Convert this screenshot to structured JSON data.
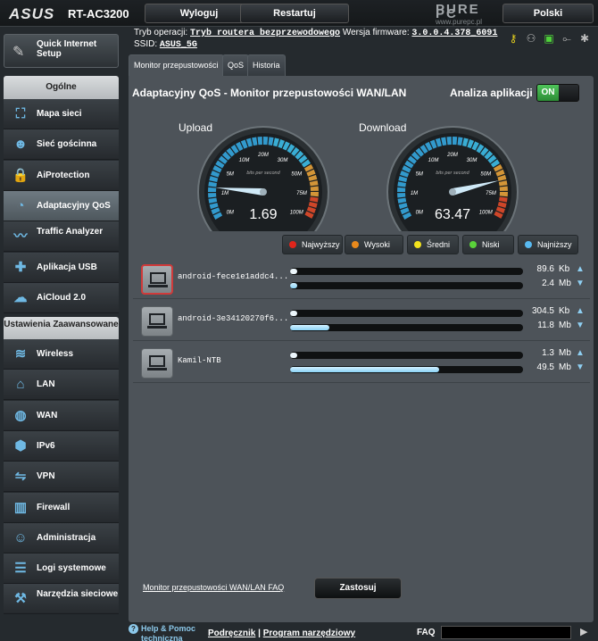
{
  "header": {
    "brand": "ASUS",
    "model": "RT-AC3200",
    "logout_label": "Wyloguj",
    "restart_label": "Restartuj",
    "language": "Polski"
  },
  "watermark": {
    "line1": "PURE",
    "line2": "PC",
    "line3": "www.purepc.pl"
  },
  "info": {
    "mode_label": "Tryb operacji:",
    "mode_value": "Tryb routera bezprzewodowego",
    "firmware_label": "Wersja firmware:",
    "firmware_value": "3.0.0.4.378_6091",
    "ssid_label": "SSID:",
    "ssid_value": "ASUS_5G"
  },
  "status_icons": [
    "key-icon",
    "network-clients-icon",
    "wan-status-icon",
    "usb-icon",
    "settings-icon"
  ],
  "sidebar": {
    "qis_label": "Quick Internet Setup",
    "general_heading": "Ogólne",
    "general": [
      {
        "label": "Mapa sieci",
        "icon": "network-map-icon"
      },
      {
        "label": "Sieć gościnna",
        "icon": "guest-network-icon"
      },
      {
        "label": "AiProtection",
        "icon": "lock-icon"
      },
      {
        "label": "Adaptacyjny QoS",
        "icon": "speedometer-icon",
        "active": true
      },
      {
        "label": "Traffic Analyzer",
        "icon": "chart-icon"
      },
      {
        "label": "Aplikacja USB",
        "icon": "puzzle-icon"
      },
      {
        "label": "AiCloud 2.0",
        "icon": "cloud-icon"
      }
    ],
    "advanced_heading": "Ustawienia Zaawansowane",
    "advanced": [
      {
        "label": "Wireless",
        "icon": "wifi-icon"
      },
      {
        "label": "LAN",
        "icon": "home-icon"
      },
      {
        "label": "WAN",
        "icon": "globe-icon"
      },
      {
        "label": "IPv6",
        "icon": "ipv6-icon"
      },
      {
        "label": "VPN",
        "icon": "vpn-icon"
      },
      {
        "label": "Firewall",
        "icon": "firewall-icon"
      },
      {
        "label": "Administracja",
        "icon": "admin-icon"
      },
      {
        "label": "Logi systemowe",
        "icon": "log-icon"
      },
      {
        "label": "Narzędzia sieciowe",
        "icon": "tools-icon"
      }
    ]
  },
  "tabs": [
    {
      "label": "Monitor przepustowości",
      "active": true
    },
    {
      "label": "QoS",
      "active": false
    },
    {
      "label": "Historia",
      "active": false
    }
  ],
  "main": {
    "title": "Adaptacyjny QoS - Monitor przepustowości WAN/LAN",
    "app_analysis_label": "Analiza aplikacji",
    "toggle_state": "ON"
  },
  "gauges": [
    {
      "label": "Upload",
      "value": "1.69",
      "level": 1.69
    },
    {
      "label": "Download",
      "value": "63.47",
      "level": 63.47
    }
  ],
  "gauge_ticks": [
    "0M",
    "1M",
    "5M",
    "10M",
    "20M",
    "30M",
    "50M",
    "75M",
    "100M"
  ],
  "gauge_unit": "bits per second",
  "priorities": [
    {
      "label": "Najwyższy",
      "color": "#e0251b"
    },
    {
      "label": "Wysoki",
      "color": "#e8891c"
    },
    {
      "label": "Średni",
      "color": "#f2e21d"
    },
    {
      "label": "Niski",
      "color": "#5ad23a"
    },
    {
      "label": "Najniższy",
      "color": "#58b9f0"
    }
  ],
  "devices": [
    {
      "name": "android-fece1e1addc4...",
      "selected": true,
      "up_value": "89.6",
      "up_unit": "Kb",
      "up_fill": 0.005,
      "down_value": "2.4",
      "down_unit": "Mb",
      "down_fill": 0.03
    },
    {
      "name": "android-3e34120270f6...",
      "selected": false,
      "up_value": "304.5",
      "up_unit": "Kb",
      "up_fill": 0.006,
      "down_value": "11.8",
      "down_unit": "Mb",
      "down_fill": 0.17
    },
    {
      "name": "Kamil-NTB",
      "selected": false,
      "up_value": "1.3",
      "up_unit": "Mb",
      "up_fill": 0.006,
      "down_value": "49.5",
      "down_unit": "Mb",
      "down_fill": 0.64
    }
  ],
  "faq_link": "Monitor przepustowości WAN/LAN FAQ",
  "apply_label": "Zastosuj",
  "footer": {
    "help_line1": "Help & Pomoc",
    "help_line2": "techniczna",
    "manual": "Podręcznik",
    "separator": "|",
    "utility": "Program narzędziowy",
    "faq": "FAQ"
  }
}
